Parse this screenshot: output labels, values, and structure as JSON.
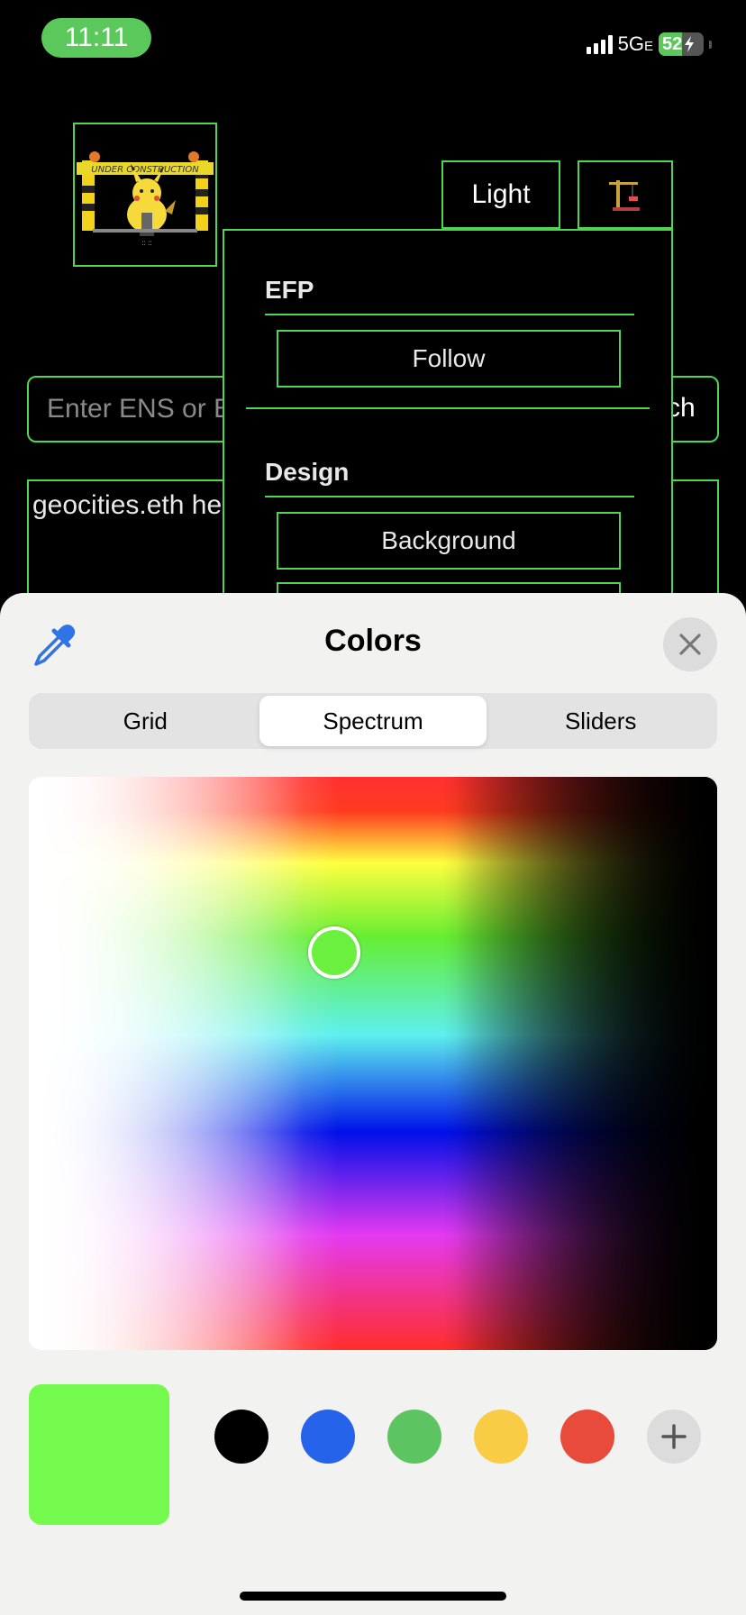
{
  "status_bar": {
    "time": "11:11",
    "network": "5G",
    "network_suffix": "E",
    "battery": "52",
    "battery_level": 0.52
  },
  "page": {
    "logo_alt": "UNDER CONSTRUCTION",
    "theme_button_label": "Light",
    "search_placeholder": "Enter ENS or B",
    "search_button_label": "ch",
    "textarea_text": "geocities.eth he"
  },
  "dropdown": {
    "sections": [
      {
        "title": "EFP",
        "buttons": [
          "Follow"
        ]
      },
      {
        "title": "Design",
        "buttons": [
          "Background"
        ]
      }
    ]
  },
  "color_picker": {
    "title": "Colors",
    "tabs": [
      "Grid",
      "Spectrum",
      "Sliders"
    ],
    "active_tab": "Spectrum",
    "selected_color": "#74FA4C",
    "saved_colors": [
      "#000000",
      "#2563EB",
      "#5CC460",
      "#F8CD45",
      "#E84A3C"
    ],
    "icons": {
      "eyedropper": "eyedropper-icon",
      "close": "close-icon",
      "add": "plus-icon"
    }
  },
  "colors": {
    "accent": "#4FD64F",
    "background": "#000000"
  }
}
